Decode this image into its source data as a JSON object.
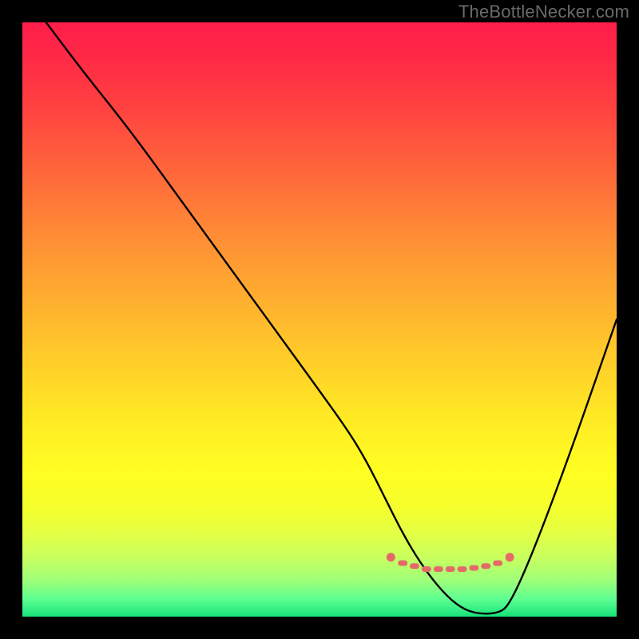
{
  "watermark": "TheBottleNecker.com",
  "chart_data": {
    "type": "line",
    "title": "",
    "xlabel": "",
    "ylabel": "",
    "xlim": [
      0,
      100
    ],
    "ylim": [
      0,
      100
    ],
    "series": [
      {
        "name": "bottleneck-curve",
        "x": [
          4,
          10,
          18,
          26,
          34,
          42,
          50,
          55,
          58,
          61,
          64,
          67,
          70,
          73,
          76,
          80,
          82,
          86,
          92,
          100
        ],
        "y": [
          100,
          92,
          82,
          71,
          60,
          49,
          38,
          31,
          26,
          20,
          14,
          9,
          5,
          2,
          0.5,
          0.5,
          2,
          11,
          27,
          50
        ]
      }
    ],
    "markers": {
      "name": "flat-region-dots",
      "color": "#e46a6a",
      "x": [
        62,
        64,
        66,
        68,
        70,
        72,
        74,
        76,
        78,
        80,
        82
      ],
      "y": [
        10,
        9,
        8.5,
        8,
        8,
        8,
        8,
        8.2,
        8.5,
        9,
        10
      ]
    },
    "gradient_stops": [
      {
        "pos": 0,
        "color": "#ff1d4a"
      },
      {
        "pos": 14,
        "color": "#ff4040"
      },
      {
        "pos": 40,
        "color": "#ff9a33"
      },
      {
        "pos": 66,
        "color": "#ffe824"
      },
      {
        "pos": 86,
        "color": "#e3ff44"
      },
      {
        "pos": 100,
        "color": "#17e37a"
      }
    ]
  }
}
